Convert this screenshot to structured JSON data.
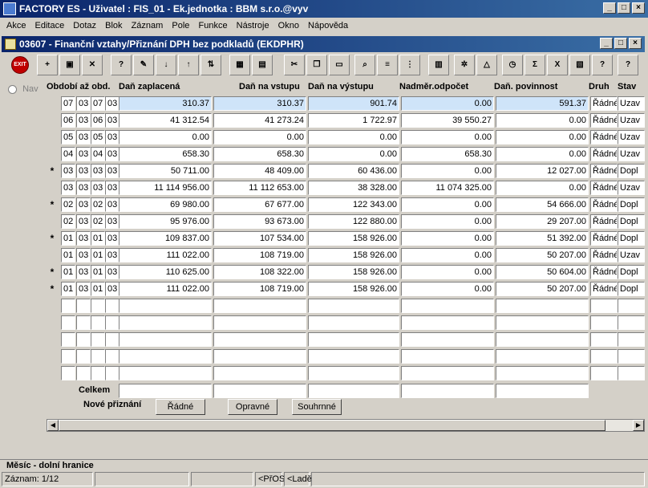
{
  "app": {
    "title": "FACTORY ES - Uživatel : FIS_01 - Ek.jednotka : BBM s.r.o.@vyv"
  },
  "menu": [
    "Akce",
    "Editace",
    "Dotaz",
    "Blok",
    "Záznam",
    "Pole",
    "Funkce",
    "Nástroje",
    "Okno",
    "Nápověda"
  ],
  "form": {
    "title": "03607 - Finanční vztahy/Přiznání DPH bez podkladů (EKDPHR)"
  },
  "toolbar": {
    "exit_label": "EXIT",
    "icons": [
      "exit-icon",
      "insert-record-icon",
      "save-icon",
      "delete-record-icon",
      "query-icon",
      "edit-icon",
      "sort-asc-icon",
      "sort-desc-icon",
      "sort-icon",
      "cut-icon",
      "copy-icon",
      "paste-icon",
      "search-icon",
      "list-icon",
      "columns-icon",
      "calculator-icon",
      "settings-icon",
      "chart-icon",
      "clock-icon",
      "sum-icon",
      "excel-icon",
      "report-icon",
      "help-icon",
      "context-help-icon"
    ]
  },
  "nav": {
    "label": "Nav"
  },
  "grid": {
    "headers": {
      "period": "Období až obd.",
      "paid": "Daň zaplacená",
      "input": "Daň na vstupu",
      "output": "Daň na výstupu",
      "excess": "Nadměr.odpočet",
      "liability": "Daň. povinnost",
      "kind": "Druh",
      "state": "Stav"
    },
    "rows": [
      {
        "mark": "",
        "m1": "07",
        "y1": "03",
        "m2": "07",
        "y2": "03",
        "paid": "310.37",
        "input": "310.37",
        "output": "901.74",
        "excess": "0.00",
        "liability": "591.37",
        "kind": "Řádné",
        "state": "Uzav"
      },
      {
        "mark": "",
        "m1": "06",
        "y1": "03",
        "m2": "06",
        "y2": "03",
        "paid": "41 312.54",
        "input": "41 273.24",
        "output": "1 722.97",
        "excess": "39 550.27",
        "liability": "0.00",
        "kind": "Řádné",
        "state": "Uzav"
      },
      {
        "mark": "",
        "m1": "05",
        "y1": "03",
        "m2": "05",
        "y2": "03",
        "paid": "0.00",
        "input": "0.00",
        "output": "0.00",
        "excess": "0.00",
        "liability": "0.00",
        "kind": "Řádné",
        "state": "Uzav"
      },
      {
        "mark": "",
        "m1": "04",
        "y1": "03",
        "m2": "04",
        "y2": "03",
        "paid": "658.30",
        "input": "658.30",
        "output": "0.00",
        "excess": "658.30",
        "liability": "0.00",
        "kind": "Řádné",
        "state": "Uzav"
      },
      {
        "mark": "*",
        "m1": "03",
        "y1": "03",
        "m2": "03",
        "y2": "03",
        "paid": "50 711.00",
        "input": "48 409.00",
        "output": "60 436.00",
        "excess": "0.00",
        "liability": "12 027.00",
        "kind": "Řádné",
        "state": "Dopl"
      },
      {
        "mark": "",
        "m1": "03",
        "y1": "03",
        "m2": "03",
        "y2": "03",
        "paid": "11 114 956.00",
        "input": "11 112 653.00",
        "output": "38 328.00",
        "excess": "11 074 325.00",
        "liability": "0.00",
        "kind": "Řádné",
        "state": "Uzav"
      },
      {
        "mark": "*",
        "m1": "02",
        "y1": "03",
        "m2": "02",
        "y2": "03",
        "paid": "69 980.00",
        "input": "67 677.00",
        "output": "122 343.00",
        "excess": "0.00",
        "liability": "54 666.00",
        "kind": "Řádné",
        "state": "Dopl"
      },
      {
        "mark": "",
        "m1": "02",
        "y1": "03",
        "m2": "02",
        "y2": "03",
        "paid": "95 976.00",
        "input": "93 673.00",
        "output": "122 880.00",
        "excess": "0.00",
        "liability": "29 207.00",
        "kind": "Řádné",
        "state": "Dopl"
      },
      {
        "mark": "*",
        "m1": "01",
        "y1": "03",
        "m2": "01",
        "y2": "03",
        "paid": "109 837.00",
        "input": "107 534.00",
        "output": "158 926.00",
        "excess": "0.00",
        "liability": "51 392.00",
        "kind": "Řádné",
        "state": "Dopl"
      },
      {
        "mark": "",
        "m1": "01",
        "y1": "03",
        "m2": "01",
        "y2": "03",
        "paid": "111 022.00",
        "input": "108 719.00",
        "output": "158 926.00",
        "excess": "0.00",
        "liability": "50 207.00",
        "kind": "Řádné",
        "state": "Uzav"
      },
      {
        "mark": "*",
        "m1": "01",
        "y1": "03",
        "m2": "01",
        "y2": "03",
        "paid": "110 625.00",
        "input": "108 322.00",
        "output": "158 926.00",
        "excess": "0.00",
        "liability": "50 604.00",
        "kind": "Řádné",
        "state": "Dopl"
      },
      {
        "mark": "*",
        "m1": "01",
        "y1": "03",
        "m2": "01",
        "y2": "03",
        "paid": "111 022.00",
        "input": "108 719.00",
        "output": "158 926.00",
        "excess": "0.00",
        "liability": "50 207.00",
        "kind": "Řádné",
        "state": "Dopl"
      }
    ],
    "total_label": "Celkem",
    "new_label": "Nové přiznání",
    "buttons": [
      "Řádné",
      "Opravné",
      "Souhrnné"
    ]
  },
  "hint": "Měsíc - dolní hranice",
  "status": {
    "record": "Záznam: 1/12",
    "mode1": "<PřOS",
    "mode2": "<Ladě"
  }
}
